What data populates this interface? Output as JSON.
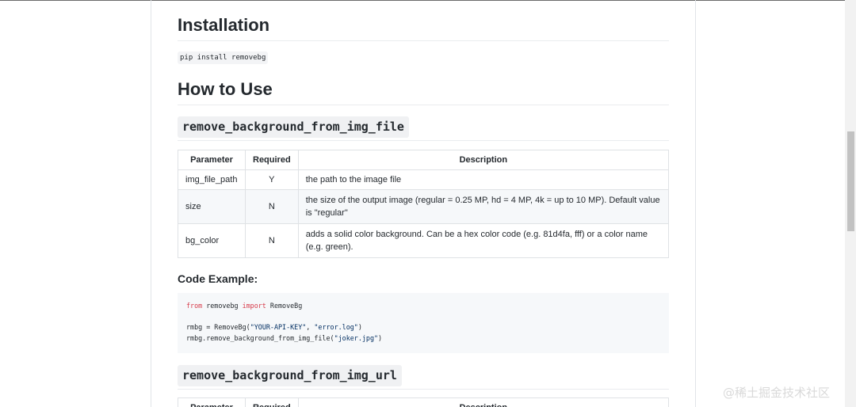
{
  "installation": {
    "heading": "Installation",
    "command": "pip install removebg"
  },
  "how_to_use": {
    "heading": "How to Use"
  },
  "section1": {
    "title": "remove_background_from_img_file",
    "table": {
      "headers": [
        "Parameter",
        "Required",
        "Description"
      ],
      "rows": [
        {
          "param": "img_file_path",
          "required": "Y",
          "desc": "the path to the image file"
        },
        {
          "param": "size",
          "required": "N",
          "desc": "the size of the output image (regular = 0.25 MP, hd = 4 MP, 4k = up to 10 MP). Default value is \"regular\""
        },
        {
          "param": "bg_color",
          "required": "N",
          "desc": "adds a solid color background. Can be a hex color code (e.g. 81d4fa, fff) or a color name (e.g. green)."
        }
      ]
    },
    "code_example_label": "Code Example:",
    "code": {
      "line1_from": "from",
      "line1_module": " removebg ",
      "line1_import": "import",
      "line1_name": " RemoveBg",
      "line3_prefix": "rmbg = RemoveBg(",
      "line3_arg1": "\"YOUR-API-KEY\"",
      "line3_sep": ", ",
      "line3_arg2": "\"error.log\"",
      "line3_suffix": ")",
      "line4_prefix": "rmbg.remove_background_from_img_file(",
      "line4_arg": "\"joker.jpg\"",
      "line4_suffix": ")"
    }
  },
  "section2": {
    "title": "remove_background_from_img_url",
    "table": {
      "headers": [
        "Parameter",
        "Required",
        "Description"
      ]
    }
  },
  "watermark": "@稀土掘金技术社区",
  "colors": {
    "keyword": "#d73a49",
    "string": "#032f62",
    "code_bg": "#f6f8fa"
  }
}
